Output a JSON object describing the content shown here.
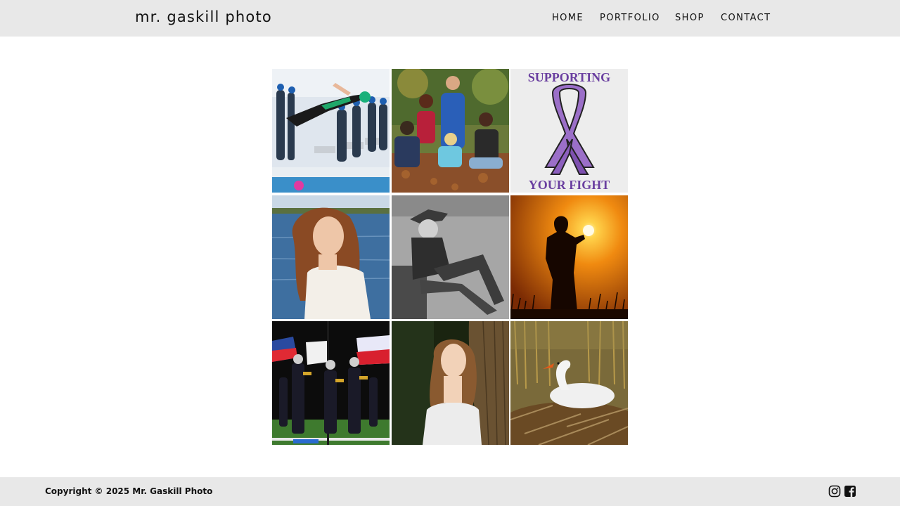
{
  "site": {
    "title": "mr. gaskill photo"
  },
  "nav": {
    "items": [
      {
        "label": "HOME"
      },
      {
        "label": "PORTFOLIO"
      },
      {
        "label": "SHOP"
      },
      {
        "label": "CONTACT"
      }
    ]
  },
  "gallery": {
    "tiles": [
      {
        "subject": "swimmer-diving-photo"
      },
      {
        "subject": "family-group-autumn-photo"
      },
      {
        "subject": "supporting-your-fight-ribbon",
        "top_text": "SUPPORTING",
        "bottom_text": "YOUR FIGHT",
        "ribbon_color": "#9b6fc8"
      },
      {
        "subject": "girl-by-water-portrait-photo"
      },
      {
        "subject": "boy-sitting-black-white-photo"
      },
      {
        "subject": "sunset-silhouette-photo"
      },
      {
        "subject": "marching-band-photo"
      },
      {
        "subject": "girl-by-tree-portrait-photo"
      },
      {
        "subject": "swan-on-nest-photo"
      }
    ]
  },
  "footer": {
    "copyright": "Copyright © 2025 Mr. Gaskill Photo",
    "social": [
      {
        "icon": "instagram-icon"
      },
      {
        "icon": "facebook-icon"
      }
    ]
  },
  "colors": {
    "header_bg": "#e8e8e8",
    "footer_bg": "#e8e8e8",
    "text": "#111111",
    "ribbon_purple": "#9b6fc8",
    "ribbon_text": "#6a3fa0"
  }
}
